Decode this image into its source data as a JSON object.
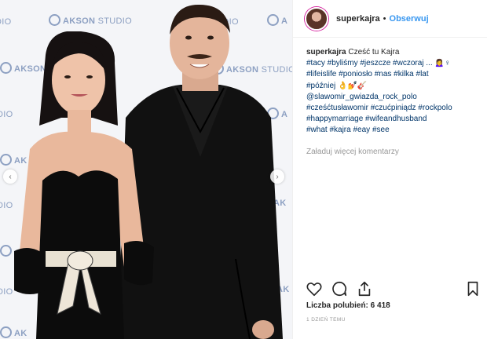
{
  "photo": {
    "watermark_brand": "AKSON",
    "watermark_suffix": "STUDIO",
    "nav_left": "‹",
    "nav_right": "›"
  },
  "header": {
    "username": "superkajra",
    "separator": "•",
    "follow_label": "Obserwuj"
  },
  "caption": {
    "username": "superkajra",
    "text": "Cześć tu Kajra",
    "line1": "#tacy #byliśmy #jeszcze #wczoraj ... 🙍‍♀️♀",
    "line2": "#lifeislife #poniosło #nas #kilka #lat",
    "line3": "#później 👌💅🎸",
    "line4": "@slawomir_gwiazda_rock_polo",
    "line5": "#cześćtusławomir #czućpiniądz #rockpolo",
    "line6": "#happymarriage #wifeandhusband",
    "line7": "#what #kajra #eay #see"
  },
  "comments": {
    "load_more_label": "Załaduj więcej komentarzy"
  },
  "footer": {
    "likes_text": "Liczba polubień: 6 418",
    "time_text": "1 DZIEŃ TEMU"
  }
}
